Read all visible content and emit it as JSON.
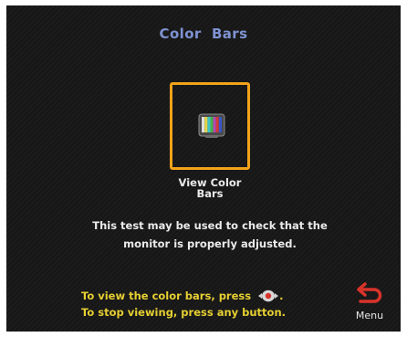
{
  "screen": {
    "title": "Color  Bars",
    "tile": {
      "icon": "color-bars-tv-icon",
      "label_line1": "View Color",
      "label_line2": "Bars",
      "border_color": "#f2a319"
    },
    "description": {
      "line1": "This test may be used to check that the",
      "line2": "monitor is properly adjusted."
    },
    "instructions": {
      "line1": "To view the color bars, press",
      "line1_end": ".",
      "line1_icon": "remote-select-icon",
      "line2": "To stop viewing, press any button."
    },
    "menu": {
      "label": "Menu",
      "icon": "back-arrow-icon"
    }
  },
  "colors": {
    "title": "#7f93d3",
    "text": "#eaeaea",
    "instructions": "#e6cf32",
    "accent_red": "#d8332a"
  }
}
